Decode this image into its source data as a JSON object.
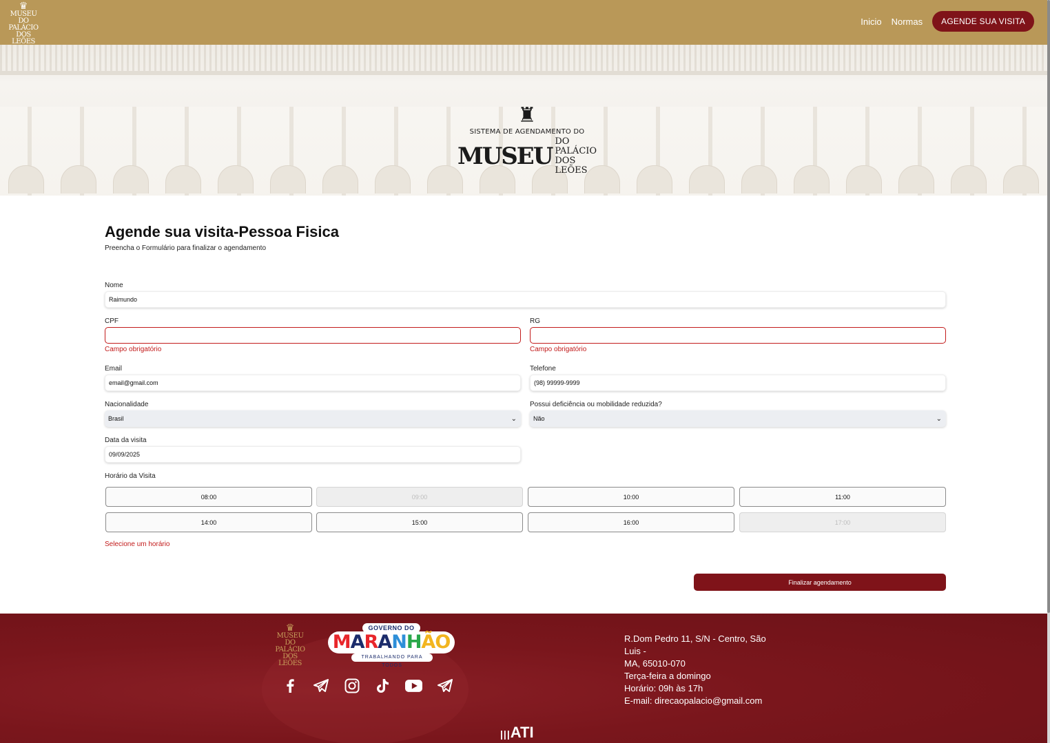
{
  "header": {
    "logo_lines": [
      "MUSEU DO",
      "PALÁCIO",
      "DOS LEÕES"
    ],
    "nav": {
      "inicio": "Inicio",
      "normas": "Normas",
      "cta": "AGENDE SUA VISITA"
    }
  },
  "banner": {
    "system_text": "SISTEMA DE AGENDAMENTO DO",
    "museu": "MUSEU",
    "do_palacio": "DO PALÁCIO",
    "dos_leoes": "DOS LEÕES"
  },
  "form": {
    "title": "Agende sua visita-Pessoa Fisica",
    "subtitle": "Preencha o Formulário para finalizar o agendamento",
    "nome": {
      "label": "Nome",
      "value": "Raimundo"
    },
    "cpf": {
      "label": "CPF",
      "value": "",
      "error": "Campo obrigatório"
    },
    "rg": {
      "label": "RG",
      "value": "",
      "error": "Campo obrigatório"
    },
    "email": {
      "label": "Email",
      "value": "email@gmail.com"
    },
    "telefone": {
      "label": "Telefone",
      "value": "(98) 99999-9999"
    },
    "nacionalidade": {
      "label": "Nacionalidade",
      "value": "Brasil"
    },
    "deficiencia": {
      "label": "Possui deficiência ou mobilidade reduzida?",
      "value": "Não"
    },
    "data_visita": {
      "label": "Data da visita",
      "value": "09/09/2025"
    },
    "horario": {
      "label": "Horário da Visita",
      "slots": [
        {
          "time": "08:00",
          "disabled": false
        },
        {
          "time": "09:00",
          "disabled": true
        },
        {
          "time": "10:00",
          "disabled": false
        },
        {
          "time": "11:00",
          "disabled": false
        },
        {
          "time": "14:00",
          "disabled": false
        },
        {
          "time": "15:00",
          "disabled": false
        },
        {
          "time": "16:00",
          "disabled": false
        },
        {
          "time": "17:00",
          "disabled": true
        }
      ],
      "error": "Selecione um horário"
    },
    "submit": "Finalizar agendamento"
  },
  "footer": {
    "logo_lines": [
      "MUSEU DO",
      "PALÁCIO",
      "DOS LEÕES"
    ],
    "gov_top": "GOVERNO DO",
    "gov_word": "MARANHÃO",
    "gov_tag": "TRABALHANDO PARA TODOS",
    "socials": [
      "facebook-icon",
      "telegram-icon",
      "instagram-icon",
      "tiktok-icon",
      "youtube-icon",
      "telegram-icon"
    ],
    "contact": {
      "address_1": "R.Dom Pedro 11, S/N - Centro, São Luis -",
      "address_2": "MA, 65010-070",
      "days": "Terça-feira a domingo",
      "hours": "Horário: 09h às 17h",
      "email": "E-mail: direcaopalacio@gmail.com"
    },
    "ati": "ATI"
  },
  "colors": {
    "header_bg": "#b99858",
    "accent": "#7f1319",
    "error": "#c21a1a"
  }
}
